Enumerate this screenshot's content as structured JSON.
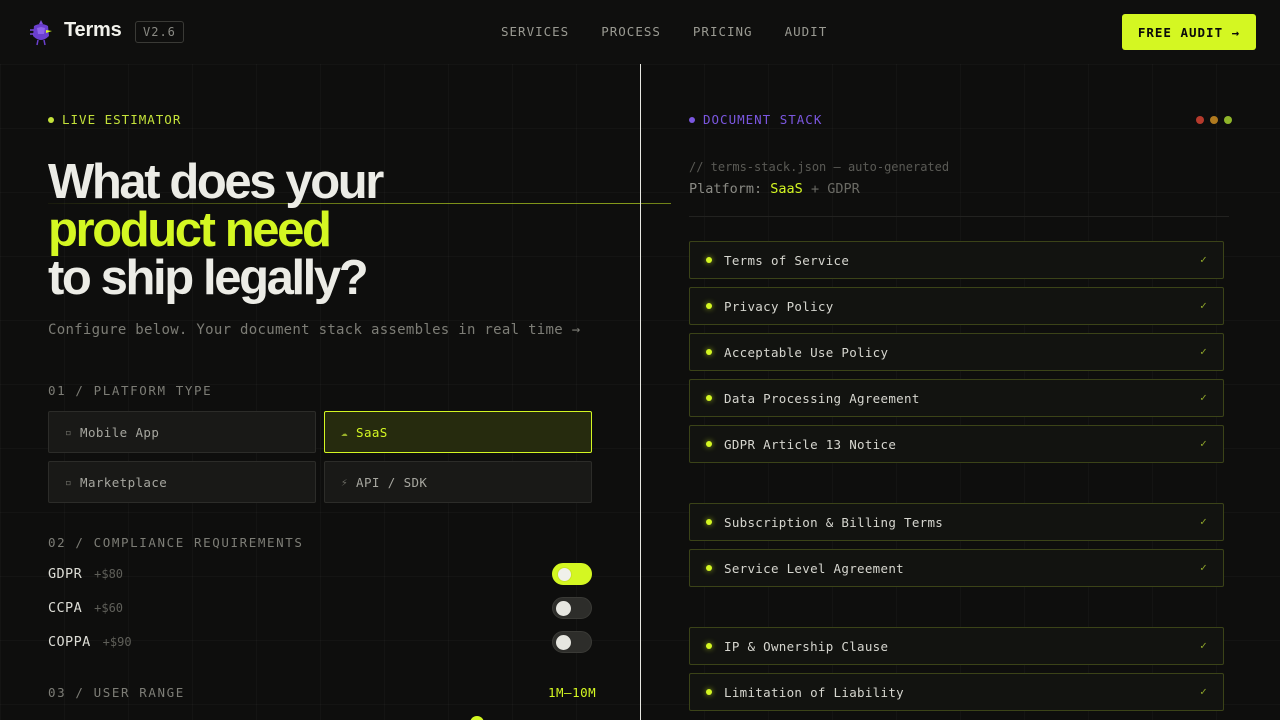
{
  "header": {
    "brand": "Terms",
    "version": "V2.6",
    "nav": [
      "SERVICES",
      "PROCESS",
      "PRICING",
      "AUDIT"
    ],
    "cta_label": "FREE AUDIT →"
  },
  "left": {
    "eyebrow": "LIVE ESTIMATOR",
    "headline_line1": "What does your",
    "headline_line2": "product need",
    "headline_line3": "to ship legally?",
    "subtext": "Configure below. Your document stack assembles in real time →",
    "section1_label": "01 / PLATFORM TYPE",
    "platform_options": [
      {
        "label": "Mobile App",
        "icon": "▫",
        "selected": false
      },
      {
        "label": "SaaS",
        "icon": "☁",
        "selected": true
      },
      {
        "label": "Marketplace",
        "icon": "▫",
        "selected": false
      },
      {
        "label": "API / SDK",
        "icon": "⚡",
        "selected": false
      }
    ],
    "section2_label": "02 / COMPLIANCE REQUIREMENTS",
    "compliance": [
      {
        "name": "GDPR",
        "price": "+$80",
        "enabled": true
      },
      {
        "name": "CCPA",
        "price": "+$60",
        "enabled": false
      },
      {
        "name": "COPPA",
        "price": "+$90",
        "enabled": false
      }
    ],
    "section3_label": "03 / USER RANGE",
    "user_range_value": "1M–10M"
  },
  "right": {
    "eyebrow": "DOCUMENT STACK",
    "comment": "// terms-stack.json — auto-generated",
    "platform_label": "Platform:",
    "platform_value": "SaaS",
    "platform_extra": "+ GDPR",
    "documents_group1": [
      "Terms of Service",
      "Privacy Policy",
      "Acceptable Use Policy",
      "Data Processing Agreement",
      "GDPR Article 13 Notice"
    ],
    "documents_group2": [
      "Subscription & Billing Terms",
      "Service Level Agreement"
    ],
    "documents_group3": [
      "IP & Ownership Clause",
      "Limitation of Liability"
    ],
    "check_mark": "✓"
  },
  "colors": {
    "accent": "#d4f722",
    "purple": "#7b57e0",
    "background": "#0e0e0d",
    "light_red": "#b53a2c",
    "light_amber": "#b07a1f",
    "light_green": "#8fb52a"
  }
}
